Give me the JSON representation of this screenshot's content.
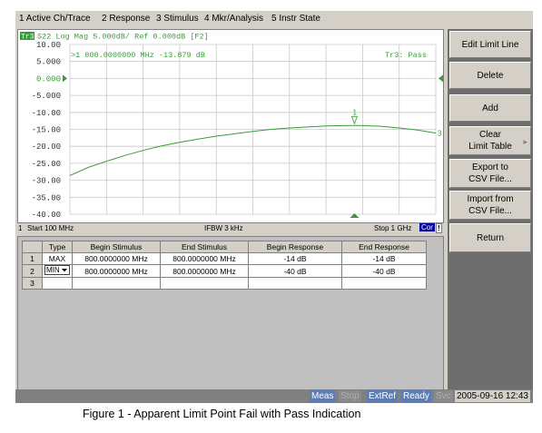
{
  "menu": [
    "1 Active Ch/Trace",
    "2 Response",
    "3 Stimulus",
    "4 Mkr/Analysis",
    "5 Instr State"
  ],
  "trace": {
    "badge": "Tr3",
    "header": "S22 Log Mag 5.000dB/ Ref 0.000dB [F2]",
    "marker_readout": ">1  800.0000000 MHz -13.879 dB",
    "pass_status": "Tr3: Pass",
    "marker_label": "1",
    "trace_end_label": "3",
    "color": "#3a9a3a"
  },
  "chart_data": {
    "type": "line",
    "ylim": [
      -40,
      10
    ],
    "y_ticks": [
      "10.00",
      "5.000",
      "0.000",
      "-5.000",
      "-10.00",
      "-15.00",
      "-20.00",
      "-25.00",
      "-30.00",
      "-35.00",
      "-40.00"
    ],
    "reference_value": "0.000",
    "x_start": "Start 100 MHz",
    "x_stop": "Stop 1 GHz",
    "ifbw": "IFBW 3 kHz",
    "series": [
      {
        "x": [
          100,
          145,
          190,
          235,
          280,
          325,
          370,
          415,
          460,
          505,
          550,
          595,
          640,
          685,
          730,
          775,
          800,
          820,
          865,
          910,
          955,
          1000
        ],
        "y": [
          -28.6,
          -26.2,
          -24.4,
          -22.7,
          -21.2,
          -19.9,
          -18.8,
          -17.9,
          -17.0,
          -16.3,
          -15.6,
          -15.0,
          -14.6,
          -14.3,
          -14.0,
          -13.9,
          -13.88,
          -13.9,
          -14.1,
          -14.6,
          -15.2,
          -16.1
        ]
      }
    ],
    "marker_x": 800
  },
  "status": {
    "channel": "1",
    "start": "Start 100 MHz",
    "ifbw": "IFBW 3 kHz",
    "stop": "Stop 1 GHz",
    "cor": "Cor",
    "warn": "!"
  },
  "limit_table": {
    "headers": [
      "Type",
      "Begin Stimulus",
      "End Stimulus",
      "Begin Response",
      "End Response"
    ],
    "rows": [
      {
        "num": "1",
        "type": "MAX",
        "begin_stim": "800.0000000 MHz",
        "end_stim": "800.0000000 MHz",
        "begin_resp": "-14 dB",
        "end_resp": "-14 dB"
      },
      {
        "num": "2",
        "type": "MIN",
        "begin_stim": "800.0000000 MHz",
        "end_stim": "800.0000000 MHz",
        "begin_resp": "-40 dB",
        "end_resp": "-40 dB"
      },
      {
        "num": "3",
        "type": "",
        "begin_stim": "",
        "end_stim": "",
        "begin_resp": "",
        "end_resp": ""
      }
    ]
  },
  "softkeys": {
    "title": "Edit Limit Line",
    "delete": "Delete",
    "add": "Add",
    "clear": "Clear\nLimit Table",
    "export": "Export to\nCSV File...",
    "import": "Import from\nCSV File...",
    "return": "Return"
  },
  "bottom_status": {
    "meas": "Meas",
    "stop": "Stop",
    "extref": "ExtRef",
    "ready": "Ready",
    "svc": "Svc",
    "datetime": "2005-09-16 12:43"
  },
  "caption": "Figure 1 - Apparent Limit Point Fail with Pass Indication"
}
